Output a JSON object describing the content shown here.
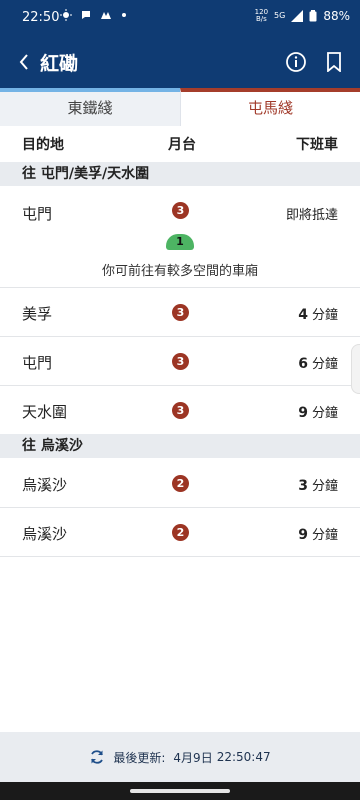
{
  "status_bar": {
    "time": "22:50",
    "net_speed_value": "120",
    "net_speed_unit": "B/s",
    "network": "5G",
    "battery": "88%"
  },
  "app_bar": {
    "title": "紅磡"
  },
  "tabs": [
    {
      "label": "東鐵綫",
      "selected": false
    },
    {
      "label": "屯馬綫",
      "selected": true
    }
  ],
  "table": {
    "headers": {
      "destination": "目的地",
      "platform": "月台",
      "next_train": "下班車"
    },
    "sections": [
      {
        "title": "往 屯門/美孚/天水圍",
        "rows": [
          {
            "destination": "屯門",
            "platform": "3",
            "eta": "即將抵達"
          },
          {
            "destination": "美孚",
            "platform": "3",
            "eta_value": "4",
            "eta_unit": "分鐘"
          },
          {
            "destination": "屯門",
            "platform": "3",
            "eta_value": "6",
            "eta_unit": "分鐘"
          },
          {
            "destination": "天水圍",
            "platform": "3",
            "eta_value": "9",
            "eta_unit": "分鐘"
          }
        ],
        "car_badge": "1",
        "car_hint": "你可前往有較多空間的車廂"
      },
      {
        "title": "往 烏溪沙",
        "rows": [
          {
            "destination": "烏溪沙",
            "platform": "2",
            "eta_value": "3",
            "eta_unit": "分鐘"
          },
          {
            "destination": "烏溪沙",
            "platform": "2",
            "eta_value": "9",
            "eta_unit": "分鐘"
          }
        ]
      }
    ]
  },
  "footer": {
    "label": "最後更新:",
    "date": "4月9日",
    "time": "22:50:47"
  },
  "colors": {
    "app_bar": "#0f3b73",
    "east_rail": "#74b3e5",
    "tuen_ma": "#a53d2b",
    "car_badge": "#4db463"
  }
}
